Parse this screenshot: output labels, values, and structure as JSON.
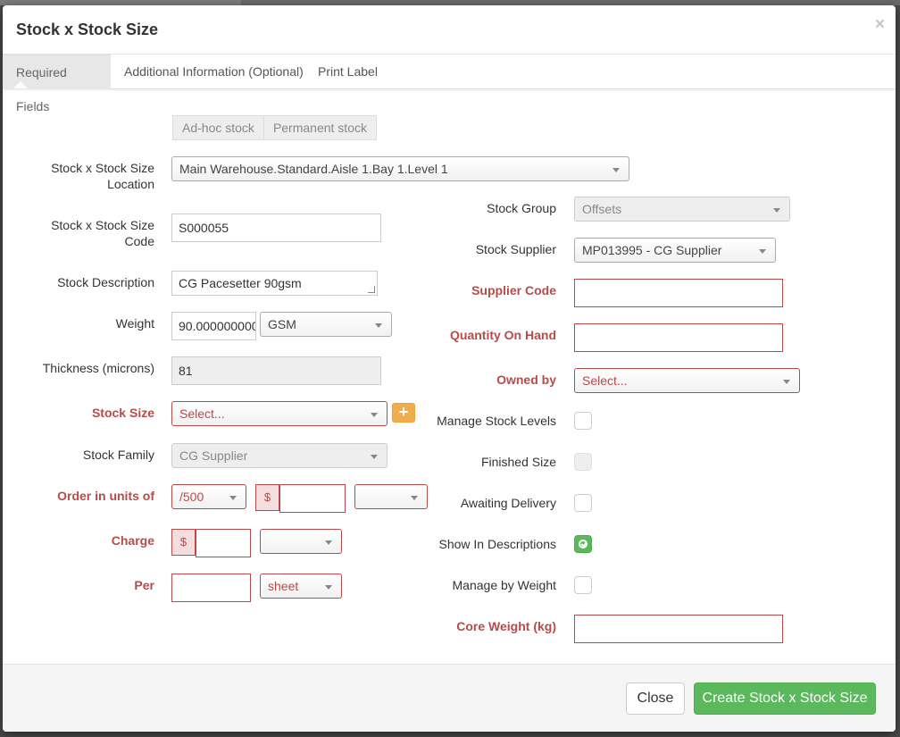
{
  "modal": {
    "title": "Stock x Stock Size",
    "close_glyph": "×"
  },
  "tabs": [
    {
      "label": "Required Fields",
      "active": true
    },
    {
      "label": "Additional Information (Optional)",
      "active": false
    },
    {
      "label": "Print Label",
      "active": false
    }
  ],
  "stock_type": {
    "options": [
      "Ad-hoc stock",
      "Permanent stock"
    ]
  },
  "left": {
    "location": {
      "label": "Stock x Stock Size Location",
      "value": "Main Warehouse.Standard.Aisle 1.Bay 1.Level 1"
    },
    "code": {
      "label": "Stock x Stock Size Code",
      "value": "S000055"
    },
    "description": {
      "label": "Stock Description",
      "value": "CG Pacesetter 90gsm"
    },
    "weight": {
      "label": "Weight",
      "value": "90.0000000000",
      "unit": "GSM"
    },
    "thickness": {
      "label": "Thickness (microns)",
      "value": "81"
    },
    "stock_size": {
      "label": "Stock Size",
      "placeholder": "Select...",
      "add_glyph": "+"
    },
    "stock_family": {
      "label": "Stock Family",
      "value": "CG Supplier"
    },
    "order_units": {
      "label": "Order in units of",
      "unit": "/500",
      "currency": "$",
      "amount": "",
      "extra": ""
    },
    "charge": {
      "label": "Charge",
      "currency": "$",
      "amount": "",
      "unit": ""
    },
    "per": {
      "label": "Per",
      "value": "",
      "unit": "sheet"
    }
  },
  "right": {
    "stock_group": {
      "label": "Stock Group",
      "value": "Offsets"
    },
    "stock_supplier": {
      "label": "Stock Supplier",
      "value": "MP013995 - CG Supplier"
    },
    "supplier_code": {
      "label": "Supplier Code",
      "value": ""
    },
    "quantity_on_hand": {
      "label": "Quantity On Hand",
      "value": ""
    },
    "owned_by": {
      "label": "Owned by",
      "placeholder": "Select..."
    },
    "manage_stock_levels": {
      "label": "Manage Stock Levels",
      "checked": false
    },
    "finished_size": {
      "label": "Finished Size",
      "checked": false
    },
    "awaiting_delivery": {
      "label": "Awaiting Delivery",
      "checked": false
    },
    "show_in_descriptions": {
      "label": "Show In Descriptions",
      "checked": true
    },
    "manage_by_weight": {
      "label": "Manage by Weight",
      "checked": false
    },
    "core_weight": {
      "label": "Core Weight (kg)",
      "value": ""
    }
  },
  "footer": {
    "close_label": "Close",
    "create_label": "Create Stock x Stock Size"
  },
  "colors": {
    "required": "#b94a48",
    "success": "#5cb85c",
    "warning": "#f0ad4e"
  }
}
